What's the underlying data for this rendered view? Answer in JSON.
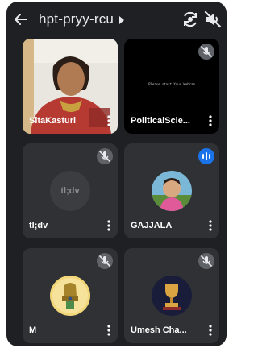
{
  "header": {
    "title": "hpt-pryy-rcu"
  },
  "tiles": [
    {
      "name": "SitaKasturi",
      "muted": false,
      "video": true
    },
    {
      "name": "PoliticalScie...",
      "muted": true,
      "screen_message": "Please start Your Webcam"
    },
    {
      "name": "tl;dv",
      "muted": true,
      "initials": "tl;dv"
    },
    {
      "name": "GAJJALA",
      "muted": false,
      "speaking": true
    },
    {
      "name": "M",
      "muted": true
    },
    {
      "name": "Umesh Cha...",
      "muted": true
    }
  ],
  "colors": {
    "background": "#1f2023",
    "tile": "#303134",
    "speaking_accent": "#1a73e8",
    "muted_badge": "#5f6368"
  }
}
